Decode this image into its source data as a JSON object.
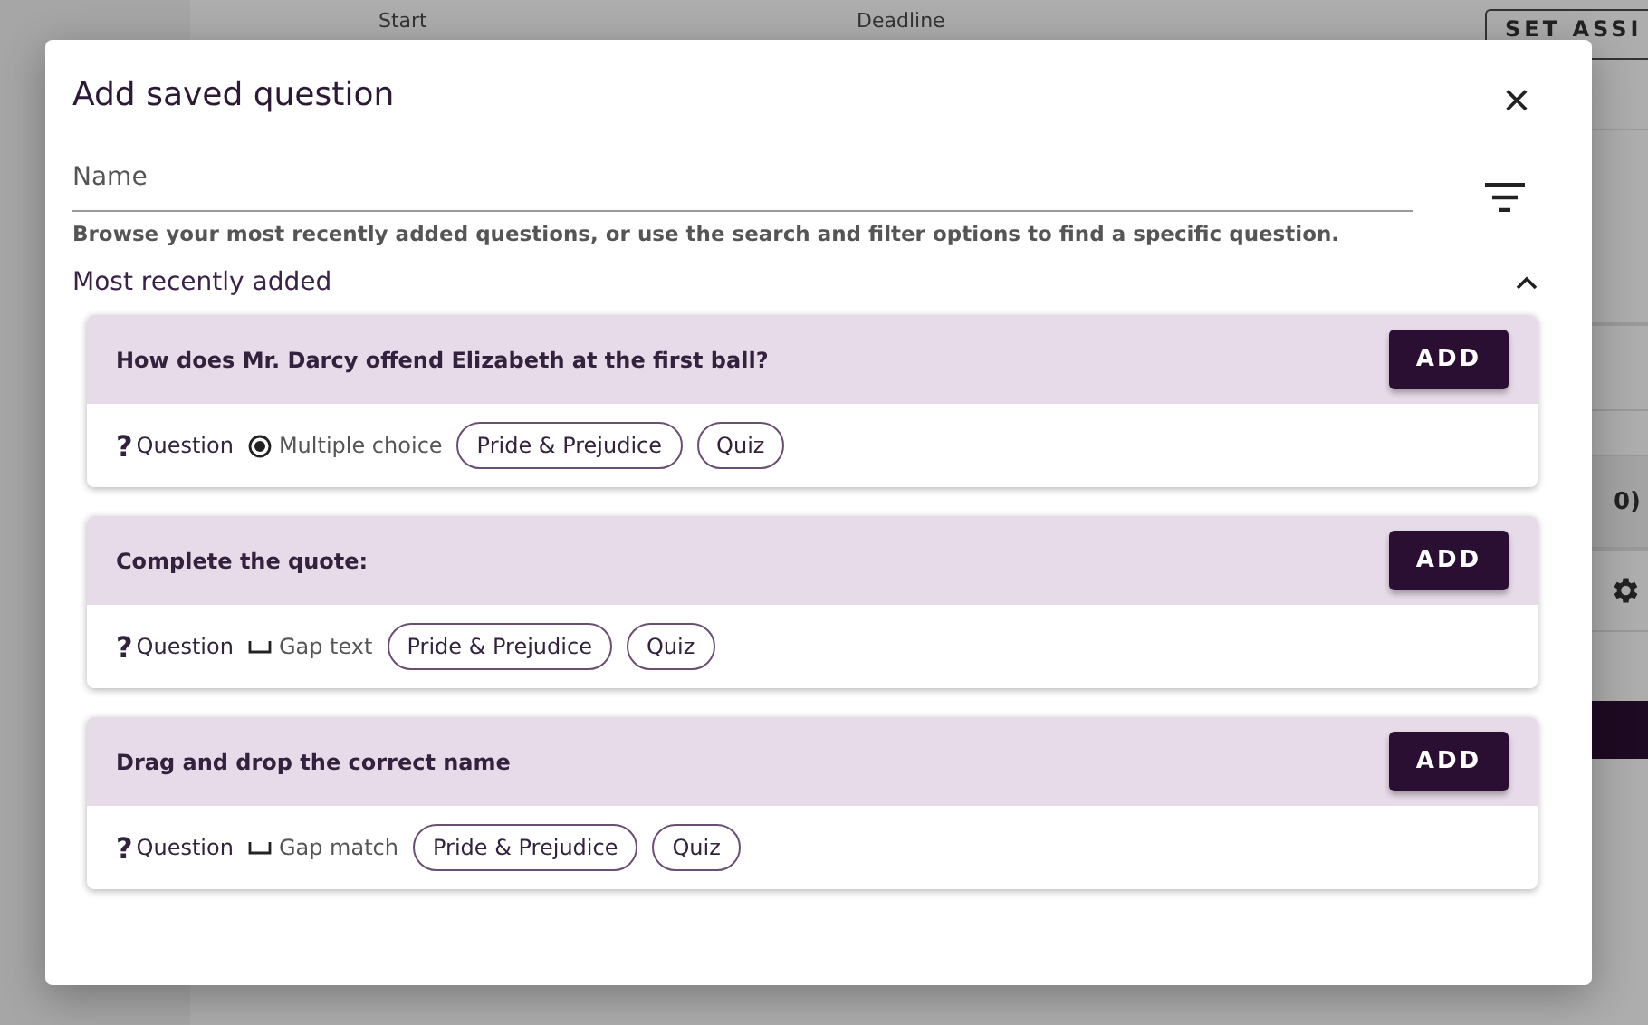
{
  "background_page": {
    "start_label": "Start",
    "deadline_label": "Deadline",
    "set_button": "SET ASSI",
    "counter": "0)"
  },
  "dialog": {
    "title": "Add saved question",
    "close": "×",
    "search": {
      "placeholder": "Name"
    },
    "helper": "Browse your most recently added questions, or use the search and filter options to find a specific question.",
    "section": {
      "title": "Most recently added",
      "expanded": true
    },
    "questions": [
      {
        "title": "How does Mr. Darcy offend Elizabeth at the first ball?",
        "add": "ADD",
        "mark": "?",
        "category": "Question",
        "kind": "choice",
        "type": "Multiple choice",
        "tags": [
          "Pride & Prejudice",
          "Quiz"
        ]
      },
      {
        "title": "Complete the quote:",
        "add": "ADD",
        "mark": "?",
        "category": "Question",
        "kind": "gap",
        "type": "Gap text",
        "tags": [
          "Pride & Prejudice",
          "Quiz"
        ]
      },
      {
        "title": "Drag and drop the correct name",
        "add": "ADD",
        "mark": "?",
        "category": "Question",
        "kind": "gap",
        "type": "Gap match",
        "tags": [
          "Pride & Prejudice",
          "Quiz"
        ]
      }
    ]
  }
}
